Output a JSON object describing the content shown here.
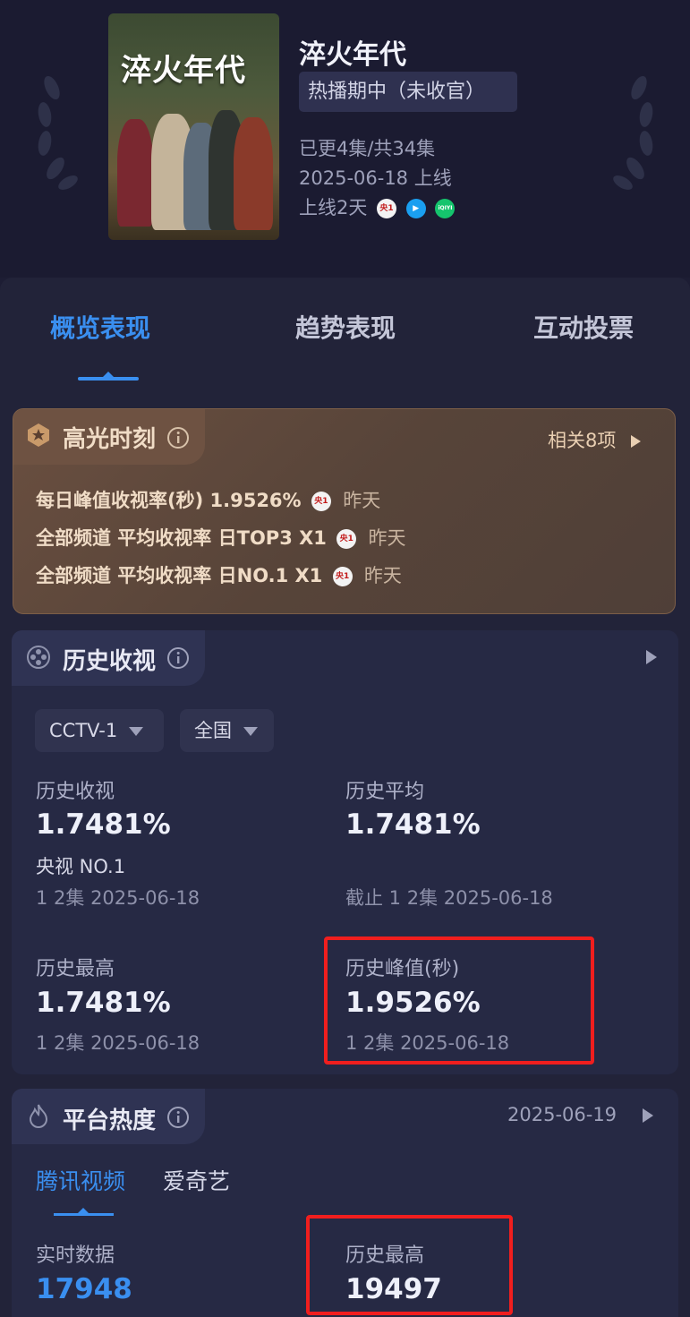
{
  "header": {
    "poster_title": "淬火年代",
    "title": "淬火年代",
    "status": "热播期中（未收官）",
    "episodes": "已更4集/共34集",
    "release": "2025-06-18 上线",
    "online_days": "上线2天",
    "platforms": [
      "cctv1-icon",
      "tencent-video-icon",
      "iqiyi-icon"
    ],
    "platform_labels": [
      "央1",
      "▶",
      "iQIYI"
    ]
  },
  "tabs": [
    "概览表现",
    "趋势表现",
    "互动投票"
  ],
  "highlight": {
    "title": "高光时刻",
    "related": "相关8项",
    "lines": [
      {
        "text": "每日峰值收视率(秒)  1.9526%",
        "when": "昨天"
      },
      {
        "text": "全部频道 平均收视率  日TOP3 X1",
        "when": "昨天"
      },
      {
        "text": "全部频道 平均收视率  日NO.1 X1",
        "when": "昨天"
      }
    ]
  },
  "history": {
    "title": "历史收视",
    "channel": "CCTV-1",
    "region": "全国",
    "stats": {
      "hist_view_label": "历史收视",
      "hist_view_value": "1.7481%",
      "hist_view_rank": "央视 NO.1",
      "hist_view_sub": "1 2集 2025-06-18",
      "hist_avg_label": "历史平均",
      "hist_avg_value": "1.7481%",
      "hist_avg_sub": "截止 1 2集 2025-06-18",
      "hist_max_label": "历史最高",
      "hist_max_value": "1.7481%",
      "hist_max_sub": "1 2集 2025-06-18",
      "hist_peak_label": "历史峰值(秒)",
      "hist_peak_value": "1.9526%",
      "hist_peak_sub": "1 2集 2025-06-18"
    }
  },
  "heat": {
    "title": "平台热度",
    "date": "2025-06-19",
    "platform_tabs": [
      "腾讯视频",
      "爱奇艺"
    ],
    "realtime_label": "实时数据",
    "realtime_value": "17948",
    "max_label": "历史最高",
    "max_value": "19497"
  },
  "colors": {
    "accent": "#3a8ff0",
    "highlight_box": "#f01e1e",
    "background": "#1d1d34"
  }
}
